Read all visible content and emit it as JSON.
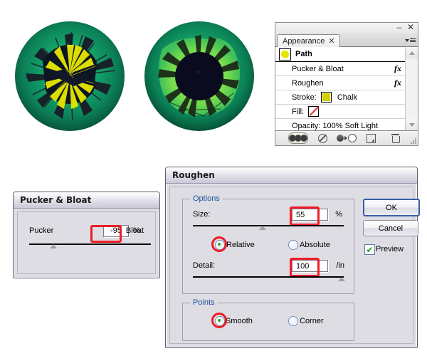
{
  "artwork": {
    "eye_left": {
      "name": "eye-artwork-pucker-bloat"
    },
    "eye_right": {
      "name": "eye-artwork-roughen"
    },
    "colors": {
      "iris_outer": "#0a6b4e",
      "iris_mid": "#12a06a",
      "iris_inner": "#3fd17a",
      "highlight": "#9cf06a",
      "pupil": "#0b0b20",
      "stroke_yellow": "#e8e800"
    }
  },
  "appearance_panel": {
    "window": {
      "minimize": "–",
      "close": "✕"
    },
    "tab": {
      "label": "Appearance",
      "close": "✕"
    },
    "menu_icon": "panel-menu-icon",
    "rows": [
      {
        "name": "path",
        "label": "Path",
        "type": "header",
        "thumb": "path-thumbnail"
      },
      {
        "name": "pucker-bloat",
        "label": "Pucker & Bloat",
        "type": "effect",
        "fx": "fx"
      },
      {
        "name": "roughen",
        "label": "Roughen",
        "type": "effect",
        "fx": "fx"
      },
      {
        "name": "stroke",
        "label": "Stroke:",
        "type": "stroke",
        "value": "Chalk",
        "swatch": "#d2d200"
      },
      {
        "name": "fill",
        "label": "Fill:",
        "type": "fill",
        "value": "",
        "swatch": "none"
      },
      {
        "name": "opacity",
        "label": "Opacity: 100% Soft Light",
        "type": "opacity"
      }
    ],
    "footer_icons": [
      "visibility-toggle-icon",
      "clear-appearance-icon",
      "reduce-to-basic-appearance-icon",
      "duplicate-item-icon",
      "delete-item-icon"
    ],
    "scrollbar": {
      "up": "▲",
      "down": "▼"
    }
  },
  "pucker_dialog": {
    "title": "Pucker & Bloat",
    "left_label": "Pucker",
    "right_label": "Bloat",
    "value": "-95",
    "unit": "%",
    "slider_percent": 17,
    "highlight_color": "#ee1c25"
  },
  "roughen_dialog": {
    "title": "Roughen",
    "options_group": "Options",
    "points_group": "Points",
    "size_label": "Size:",
    "size_value": "55",
    "size_unit": "%",
    "size_slider_percent": 44,
    "detail_label": "Detail:",
    "detail_value": "100",
    "detail_unit": "/in",
    "detail_slider_percent": 96,
    "relative_label": "Relative",
    "absolute_label": "Absolute",
    "relative_checked": true,
    "smooth_label": "Smooth",
    "corner_label": "Corner",
    "smooth_checked": true,
    "ok_label": "OK",
    "cancel_label": "Cancel",
    "preview_label": "Preview",
    "preview_checked": true,
    "check_glyph": "✔",
    "highlight_color": "#ee1c25"
  }
}
